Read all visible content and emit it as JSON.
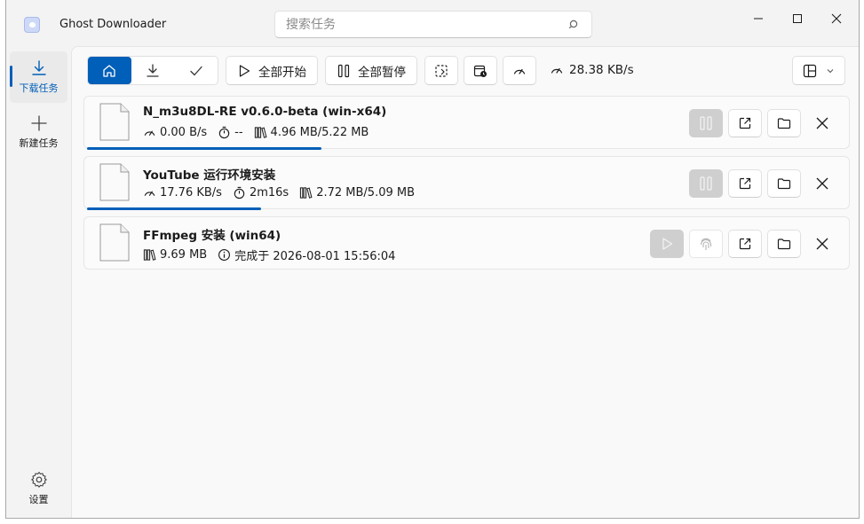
{
  "app": {
    "title": "Ghost Downloader"
  },
  "search": {
    "placeholder": "搜索任务"
  },
  "sidebar": {
    "items": [
      {
        "label": "下载任务",
        "icon": "download-icon",
        "active": true
      },
      {
        "label": "新建任务",
        "icon": "plus-icon",
        "active": false
      }
    ],
    "settings_label": "设置"
  },
  "toolbar": {
    "segments": [
      {
        "icon": "home-icon",
        "active": true
      },
      {
        "icon": "download-icon",
        "active": false
      },
      {
        "icon": "check-icon",
        "active": false
      }
    ],
    "start_all_label": "全部开始",
    "pause_all_label": "全部暂停",
    "total_speed": "28.38 KB/s"
  },
  "tasks": [
    {
      "name": "N_m3u8DL-RE v0.6.0-beta (win-x64)",
      "speed": "0.00 B/s",
      "eta": "--",
      "size": "4.96 MB/5.22 MB",
      "progress": 0.3,
      "state": "downloading"
    },
    {
      "name": "YouTube 运行环境安装",
      "speed": "17.76 KB/s",
      "eta": "2m16s",
      "size": "2.72 MB/5.09 MB",
      "progress": 0.223,
      "state": "downloading"
    },
    {
      "name": "FFmpeg 安装 (win64)",
      "size": "9.69 MB",
      "finished": "完成于 2026-08-01 15:56:04",
      "state": "completed"
    }
  ],
  "colors": {
    "accent": "#005fb8",
    "background": "#f3f3f3",
    "disabled": "#cfcfcf"
  }
}
